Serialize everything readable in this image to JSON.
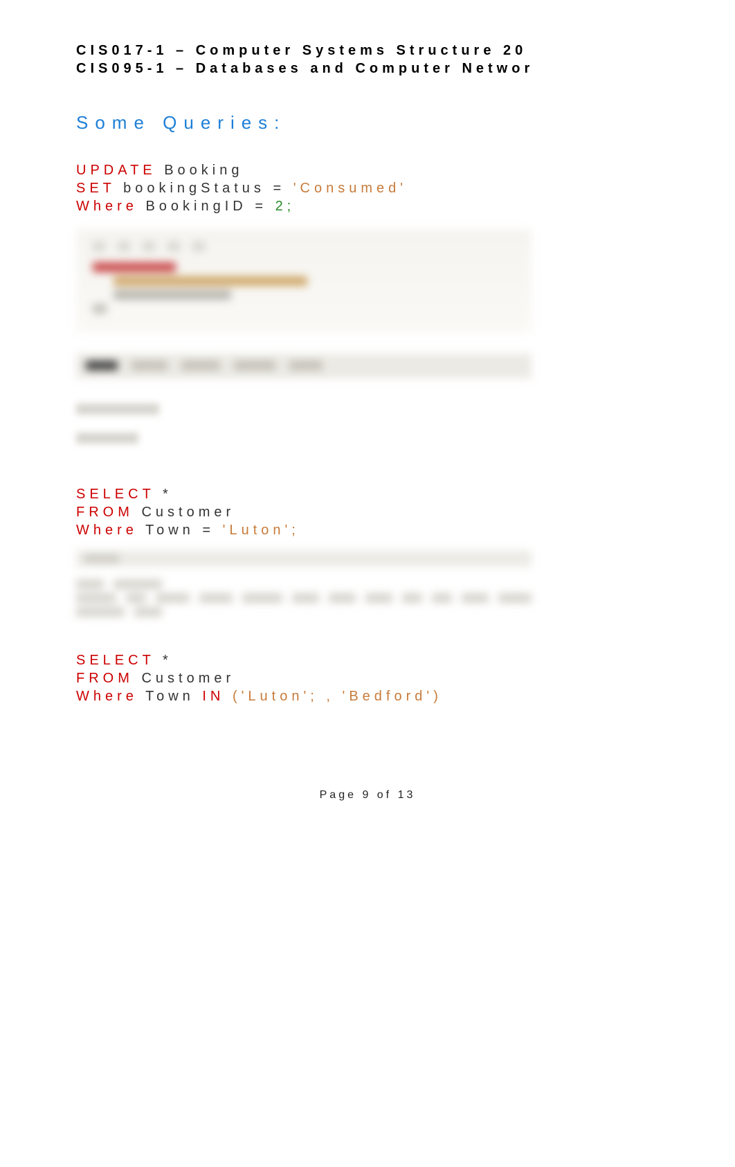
{
  "header": {
    "line1": "CIS017-1 – Computer Systems Structure 20",
    "line2": "CIS095-1 – Databases and Computer Networ"
  },
  "section_title": "Some Queries:",
  "queries": [
    {
      "l1_kw": "UPDATE",
      "l1_tbl": "Booking",
      "l2_kw": "SET",
      "l2_col": "bookingStatus",
      "l2_eq": "=",
      "l2_val": "'Consumed'",
      "l3_kw": "Where",
      "l3_col": "BookingID",
      "l3_eq": "=",
      "l3_val": "2;"
    },
    {
      "l1_kw": "SELECT",
      "l1_star": "*",
      "l2_kw": "FROM",
      "l2_tbl": "Customer",
      "l3_kw": "Where",
      "l3_col": "Town",
      "l3_eq": "=",
      "l3_val": "'Luton';"
    },
    {
      "l1_kw": "SELECT",
      "l1_star": "*",
      "l2_kw": "FROM",
      "l2_tbl": "Customer",
      "l3_kw": "Where",
      "l3_col": "Town",
      "l3_in": "IN",
      "l3_val": "('Luton'; , 'Bedford')"
    }
  ],
  "footer": "Page 9 of 13"
}
